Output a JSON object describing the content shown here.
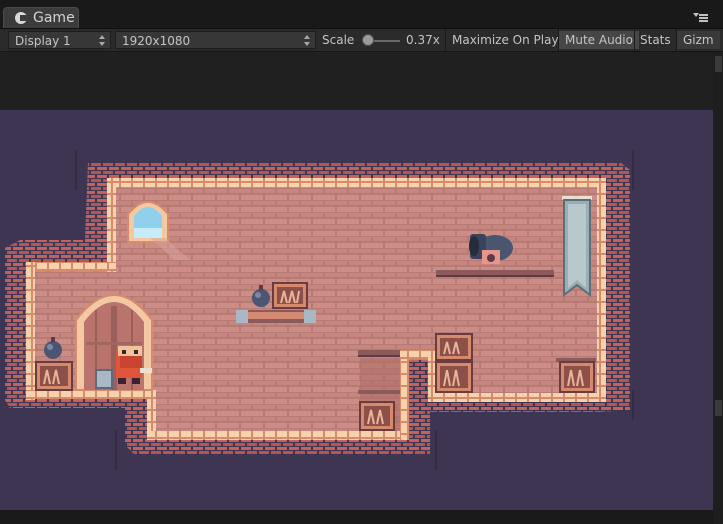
{
  "window": {
    "tab_label": "Game",
    "tab_icon": "unity-game-icon",
    "menu_icon": "window-menu-icon"
  },
  "toolbar": {
    "display": "Display 1",
    "resolution": "1920x1080",
    "scale_label": "Scale",
    "scale_value": "0.37x",
    "scale_slider_fraction": 0.0,
    "maximize_on_play": "Maximize On Play",
    "mute_audio": "Mute Audio",
    "mute_audio_active": true,
    "stats": "Stats",
    "gizmos": "Gizm"
  },
  "game_view": {
    "background_color": "#3d3552",
    "brick_color": "#c4615d",
    "wall_color": "#c98a82",
    "trim_color": "#f3c9a3",
    "objects": [
      "window",
      "cannon",
      "banner",
      "door-arch",
      "bomb",
      "bomb",
      "player-character",
      "crate",
      "crate",
      "crate",
      "crate",
      "crate",
      "crate",
      "crate",
      "platform",
      "platform",
      "platform",
      "block"
    ]
  }
}
